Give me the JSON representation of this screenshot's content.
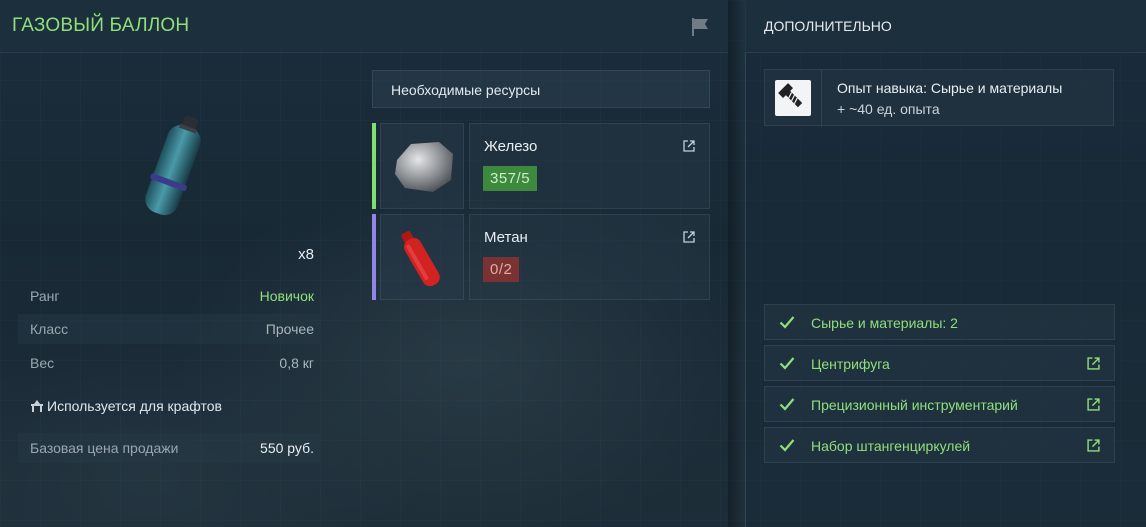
{
  "item": {
    "title": "ГАЗОВЫЙ БАЛЛОН",
    "quantity": "x8",
    "stats": [
      {
        "label": "Ранг",
        "value": "Новичок"
      },
      {
        "label": "Класс",
        "value": "Прочее"
      },
      {
        "label": "Вес",
        "value": "0,8 кг"
      }
    ],
    "crafts_label": "Используется для крафтов",
    "price_label": "Базовая цена продажи",
    "price_value": "550 руб."
  },
  "resources": {
    "header": "Необходимые ресурсы",
    "items": [
      {
        "name": "Железо",
        "count": "357/5",
        "status": "ok",
        "bar_color": "#7fe06e"
      },
      {
        "name": "Метан",
        "count": "0/2",
        "status": "missing",
        "bar_color": "#8f86e8"
      }
    ]
  },
  "additional": {
    "title": "ДОПОЛНИТЕЛЬНО",
    "skill_line1": "Опыт навыка: Сырье и материалы",
    "skill_line2": "+ ~40 ед. опыта",
    "requirements": [
      {
        "label": "Сырье и материалы: 2",
        "link": false
      },
      {
        "label": "Центрифуга",
        "link": true
      },
      {
        "label": "Прецизионный инструментарий",
        "link": true
      },
      {
        "label": "Набор штангенциркулей",
        "link": true
      }
    ]
  },
  "colors": {
    "accent_green": "#8fe07a",
    "ok_badge": "#3d8a3f",
    "missing_badge": "#7a3332"
  }
}
